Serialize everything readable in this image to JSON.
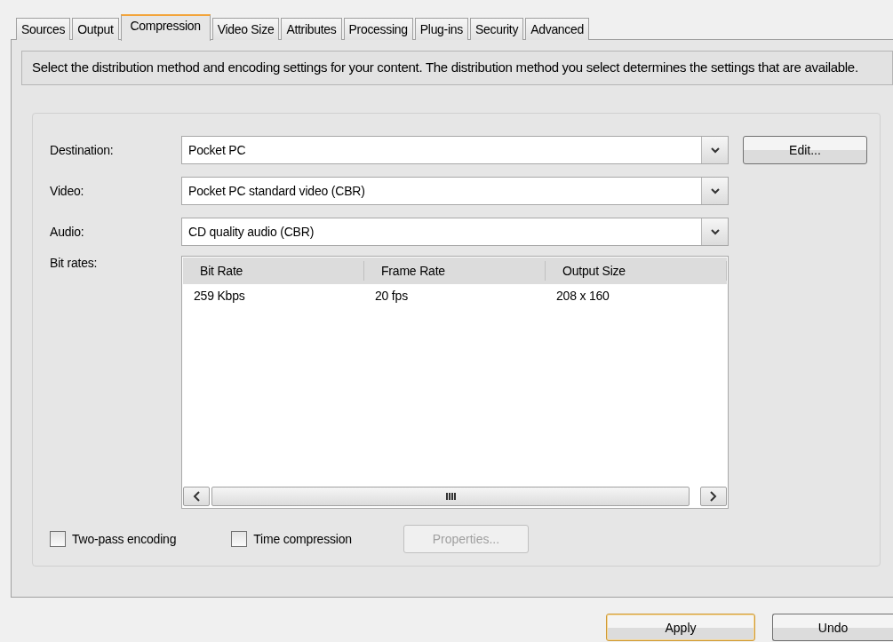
{
  "tabs": [
    {
      "label": "Sources",
      "selected": false
    },
    {
      "label": "Output",
      "selected": false
    },
    {
      "label": "Compression",
      "selected": true
    },
    {
      "label": "Video Size",
      "selected": false
    },
    {
      "label": "Attributes",
      "selected": false
    },
    {
      "label": "Processing",
      "selected": false
    },
    {
      "label": "Plug-ins",
      "selected": false
    },
    {
      "label": "Security",
      "selected": false
    },
    {
      "label": "Advanced",
      "selected": false
    }
  ],
  "description": "Select the distribution method and encoding settings for your content. The distribution method you select determines the settings that are available.",
  "fields": [
    {
      "label": "Destination:",
      "value": "Pocket PC"
    },
    {
      "label": "Video:",
      "value": "Pocket PC standard video (CBR)"
    },
    {
      "label": "Audio:",
      "value": "CD quality audio (CBR)"
    }
  ],
  "edit_button": {
    "label": "Edit..."
  },
  "bit_rates": {
    "label": "Bit rates:",
    "columns": [
      "Bit Rate",
      "Frame Rate",
      "Output Size"
    ],
    "rows": [
      [
        "259 Kbps",
        "20 fps",
        "208 x 160"
      ]
    ]
  },
  "options": [
    {
      "label": "Two-pass encoding",
      "checked": false
    },
    {
      "label": "Time compression",
      "checked": false
    }
  ],
  "properties_button": {
    "label": "Properties...",
    "disabled": true
  },
  "buttons": [
    {
      "label": "Apply",
      "default": true
    },
    {
      "label": "Undo",
      "default": false
    }
  ]
}
